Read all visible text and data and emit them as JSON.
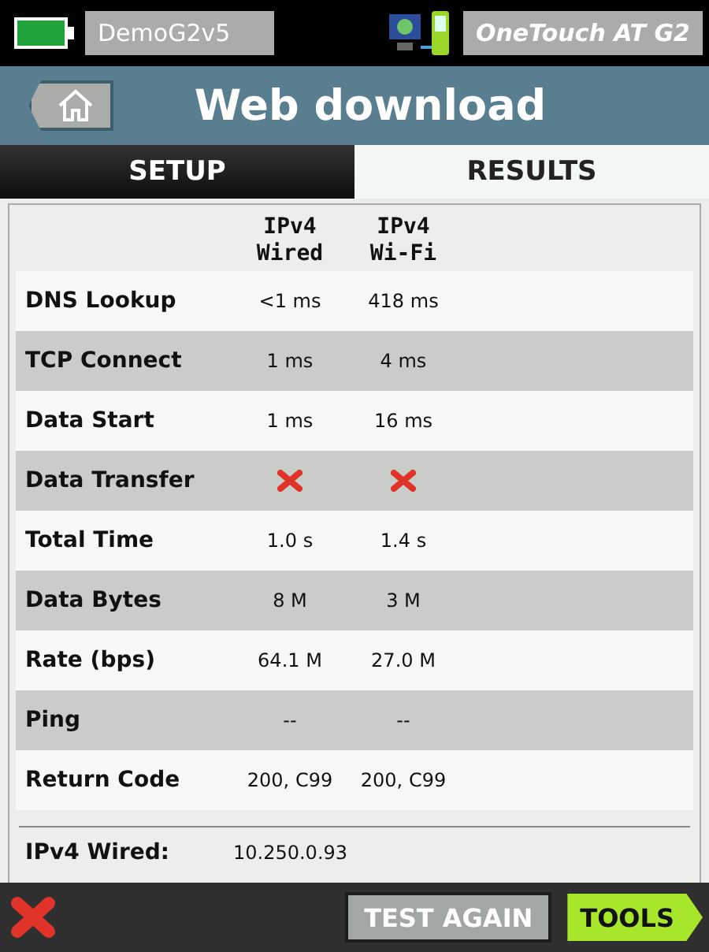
{
  "status_bar": {
    "device_name": "DemoG2v5",
    "product_name": "OneTouch AT G2"
  },
  "title_bar": {
    "title": "Web download"
  },
  "tabs": [
    {
      "label": "SETUP",
      "selected": false
    },
    {
      "label": "RESULTS",
      "selected": true
    }
  ],
  "table": {
    "columns": [
      {
        "line_1": "IPv4",
        "line_2": "Wired"
      },
      {
        "line_1": "IPv4",
        "line_2": "Wi-Fi"
      }
    ],
    "rows": [
      {
        "label": "DNS Lookup",
        "cells": [
          {
            "kind": "text",
            "text": "<1 ms"
          },
          {
            "kind": "text",
            "text": "418 ms"
          }
        ]
      },
      {
        "label": "TCP Connect",
        "cells": [
          {
            "kind": "text",
            "text": "1 ms"
          },
          {
            "kind": "text",
            "text": "4 ms"
          }
        ]
      },
      {
        "label": "Data Start",
        "cells": [
          {
            "kind": "text",
            "text": "1 ms"
          },
          {
            "kind": "text",
            "text": "16 ms"
          }
        ]
      },
      {
        "label": "Data Transfer",
        "cells": [
          {
            "kind": "fail"
          },
          {
            "kind": "fail"
          }
        ]
      },
      {
        "label": "Total Time",
        "cells": [
          {
            "kind": "text",
            "text": "1.0 s"
          },
          {
            "kind": "text",
            "text": "1.4 s"
          }
        ]
      },
      {
        "label": "Data Bytes",
        "cells": [
          {
            "kind": "text",
            "text": "8 M"
          },
          {
            "kind": "text",
            "text": "3 M"
          }
        ]
      },
      {
        "label": "Rate (bps)",
        "cells": [
          {
            "kind": "text",
            "text": "64.1 M"
          },
          {
            "kind": "text",
            "text": "27.0 M"
          }
        ]
      },
      {
        "label": "Ping",
        "cells": [
          {
            "kind": "text",
            "text": "--"
          },
          {
            "kind": "text",
            "text": "--"
          }
        ]
      },
      {
        "label": "Return Code",
        "cells": [
          {
            "kind": "text",
            "text": "200, C99"
          },
          {
            "kind": "text",
            "text": "200, C99"
          }
        ]
      }
    ]
  },
  "address": {
    "label": "IPv4 Wired:",
    "value": "10.250.0.93"
  },
  "bottom_bar": {
    "test_again": "TEST AGAIN",
    "tools": "TOOLS"
  }
}
